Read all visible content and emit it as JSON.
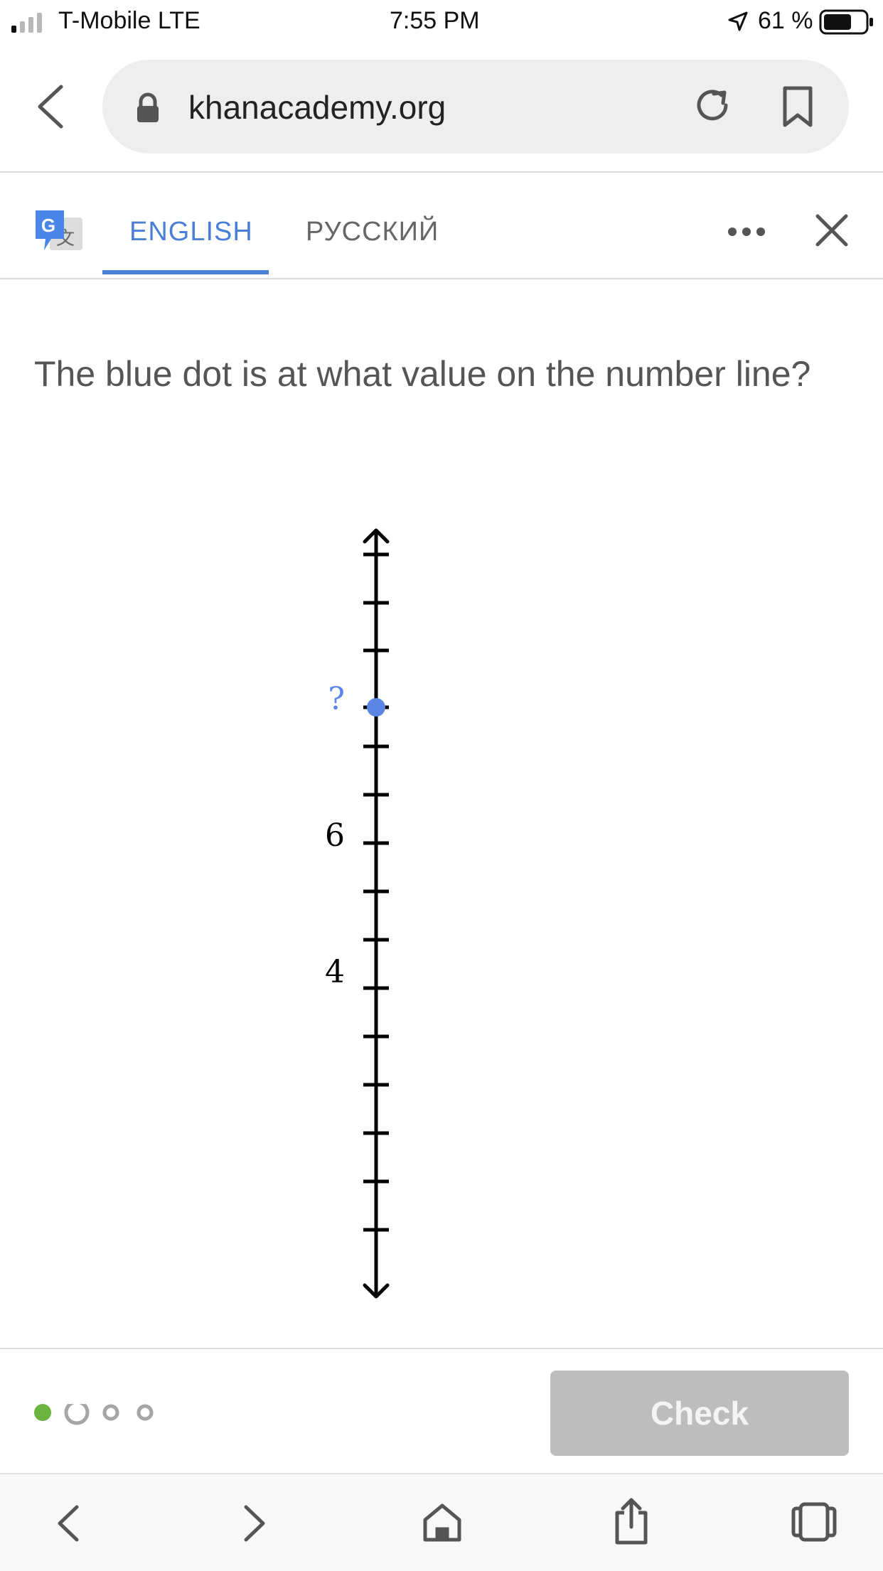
{
  "status_bar": {
    "carrier": "T-Mobile LTE",
    "time": "7:55 PM",
    "battery": "61 %"
  },
  "browser": {
    "url": "khanacademy.org"
  },
  "translate_bar": {
    "tabs": [
      {
        "label": "ENGLISH",
        "active": true
      },
      {
        "label": "РУССКИЙ",
        "active": false
      }
    ]
  },
  "exercise": {
    "question": "The blue dot is at what value on the number line?",
    "number_line": {
      "labels": [
        {
          "value": 6,
          "text": "6"
        },
        {
          "value": 4,
          "text": "4"
        }
      ],
      "point": {
        "value": 8,
        "label": "?",
        "color": "#5b86e5"
      }
    },
    "progress": {
      "completed": 1,
      "total": 4
    },
    "check_label": "Check"
  },
  "colors": {
    "accent": "#4a7fd8",
    "dot_complete": "#6db33f",
    "check_disabled": "#bdbdbd"
  }
}
